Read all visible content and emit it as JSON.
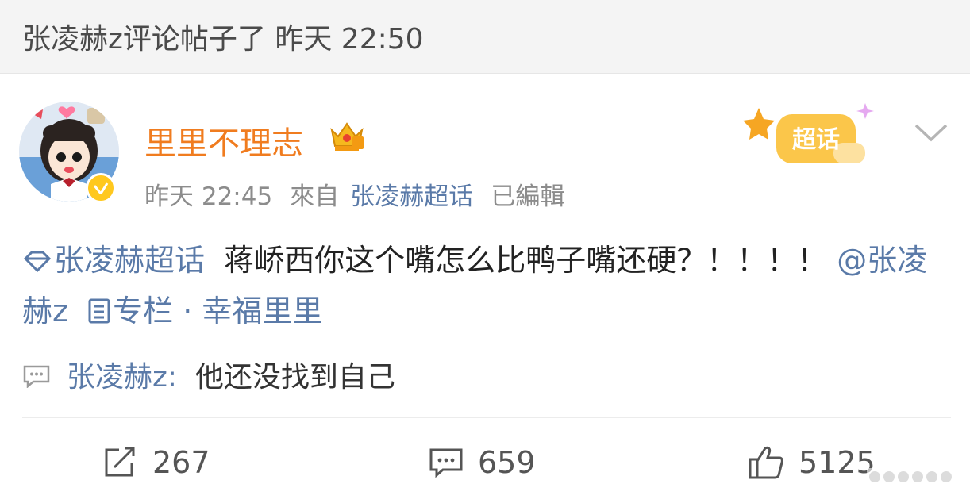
{
  "notice": {
    "text": "张凌赫z评论帖子了 昨天 22:50"
  },
  "post": {
    "author": "里里不理志",
    "time": "昨天 22:45",
    "source_prefix": "來自",
    "source_link": "张凌赫超话",
    "edited": "已編輯",
    "supertopic_badge_label": "超话",
    "content": {
      "topic_link": "张凌赫超话",
      "text_main": "蒋峤西你这个嘴怎么比鸭子嘴还硬？！！！！",
      "mention": "@张凌赫z",
      "column_label": "专栏",
      "separator": "·",
      "column_name": "幸福里里"
    },
    "featured_comment": {
      "author": "张凌赫z:",
      "text": "他还没找到自己"
    },
    "actions": {
      "repost_count": "267",
      "comment_count": "659",
      "like_count": "5125"
    }
  },
  "icons": {
    "crown": "crown-icon",
    "chevron": "chevron-down-icon",
    "topic": "supertopic-diamond-icon",
    "column": "column-icon",
    "comment_preview": "comment-icon",
    "repost": "repost-icon",
    "comment": "comment-icon",
    "like": "thumbs-up-icon"
  },
  "colors": {
    "username": "#f07c1f",
    "link": "#5a7aa8",
    "meta": "#8c8c8c",
    "badge_orange": "#f6a623"
  }
}
